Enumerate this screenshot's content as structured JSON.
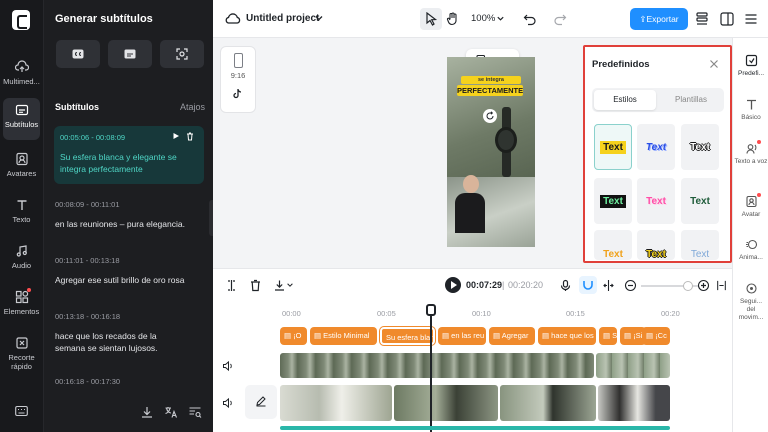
{
  "rail": {
    "items": [
      {
        "label": "Multimed...",
        "icon": "cloud-upload-icon"
      },
      {
        "label": "Subtítulos",
        "icon": "subtitles-icon"
      },
      {
        "label": "Avatares",
        "icon": "avatar-icon"
      },
      {
        "label": "Texto",
        "icon": "text-icon"
      },
      {
        "label": "Audio",
        "icon": "music-icon"
      },
      {
        "label": "Elementos",
        "icon": "shapes-icon"
      },
      {
        "label": "Recorte rápido",
        "icon": "scissors-icon"
      }
    ]
  },
  "panel": {
    "title": "Generar subtítulos",
    "subtitles_label": "Subtítulos",
    "shortcuts_label": "Atajos",
    "cues": [
      {
        "time": "00:05:06 - 00:08:09",
        "text": "Su esfera blanca y elegante se integra perfectamente"
      },
      {
        "time": "00:08:09 - 00:11:01",
        "text": "en las reuniones – pura elegancia."
      },
      {
        "time": "00:11:01 - 00:13:18",
        "text": "Agregar ese sutil brillo de oro rosa"
      },
      {
        "time": "00:13:18 - 00:16:18",
        "text": "hace que los recados de la semana se sientan lujosos."
      },
      {
        "time": "00:16:18 - 00:17:30",
        "text": ""
      }
    ]
  },
  "header": {
    "project": "Untitled project",
    "zoom": "100%",
    "export": "Exportar"
  },
  "canvas": {
    "ratio": "9:16",
    "caption_top": "se integra",
    "caption_main": "PERFECTAMENTE"
  },
  "preset": {
    "title": "Predefinidos",
    "tabs": [
      "Estilos",
      "Plantillas"
    ],
    "tiles": [
      "Text",
      "Text",
      "Text",
      "Text",
      "Text",
      "Text",
      "Text",
      "Text",
      "Text"
    ]
  },
  "right_rail": {
    "items": [
      {
        "label": "Predefi...",
        "icon": "preset-icon"
      },
      {
        "label": "Básico",
        "icon": "text-basic-icon"
      },
      {
        "label": "Texto a voz",
        "icon": "text-to-speech-icon"
      },
      {
        "label": "Avatar",
        "icon": "avatar-icon"
      },
      {
        "label": "Anima...",
        "icon": "animation-icon"
      },
      {
        "label": "Segui... del movim...",
        "icon": "tracking-icon"
      }
    ]
  },
  "timeline": {
    "current_time": "00:07:29",
    "total_time": "00:20:20",
    "ruler": [
      "00:00",
      "00:05",
      "00:10",
      "00:15",
      "00:20"
    ],
    "subtitle_clips": [
      "¡O",
      "Estilo Minimal",
      "Su esfera blar",
      "en las reu",
      "Agregar",
      "hace que los",
      "Si",
      "¡Si",
      "¡Cc"
    ]
  },
  "colors": {
    "accent": "#1f8fff",
    "highlight": "#e0403a",
    "subtitle_clip": "#f08a2c",
    "selected_text": "#4fd6c6"
  }
}
